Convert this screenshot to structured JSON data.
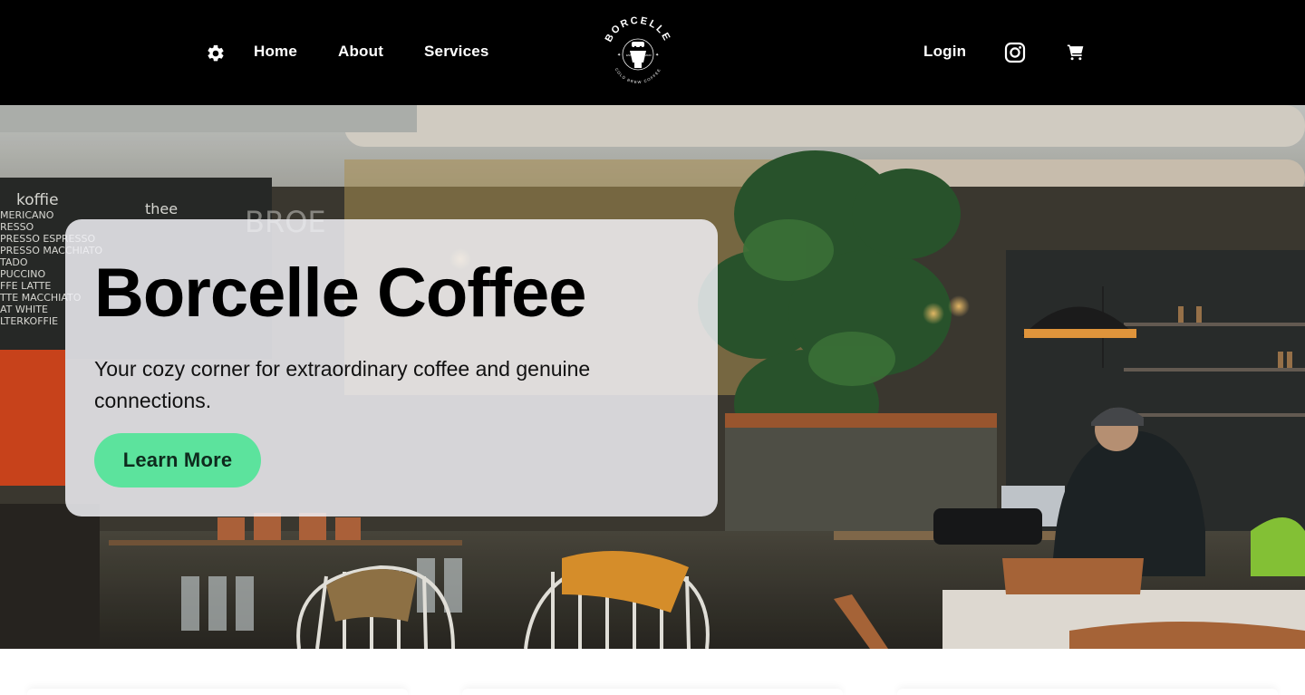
{
  "nav": {
    "settings_icon": "gear-icon",
    "links": {
      "home": "Home",
      "about": "About",
      "services": "Services",
      "login": "Login"
    },
    "instagram_icon": "instagram-icon",
    "cart_icon": "cart-icon",
    "logo": {
      "brand": "BORCELLE",
      "tagline": "COLD BREW COFFEE",
      "estd": "ESTD"
    }
  },
  "hero": {
    "title": "Borcelle Coffee",
    "subtitle": "Your cozy corner for extraordinary coffee and genuine connections.",
    "cta_label": "Learn More"
  },
  "colors": {
    "navbar_bg": "#000000",
    "cta_bg": "#5ce39d",
    "card_bg": "#f0f0f4"
  }
}
